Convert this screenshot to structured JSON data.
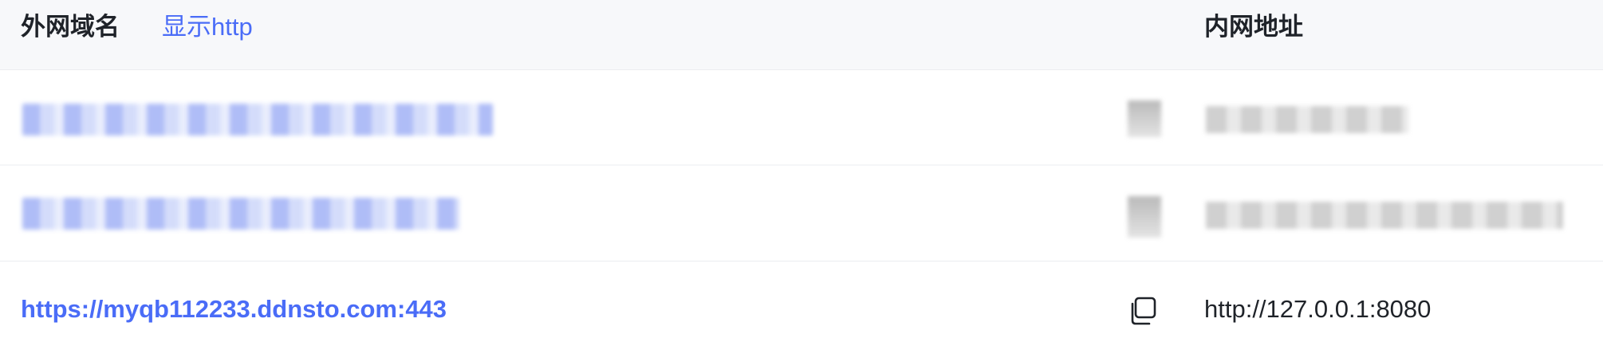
{
  "header": {
    "domain_label": "外网域名",
    "toggle_label": "显示http",
    "address_label": "内网地址"
  },
  "rows": [
    {
      "domain": "",
      "address": "",
      "redacted": true
    },
    {
      "domain": "",
      "address": "",
      "redacted": true
    },
    {
      "domain": "https://myqb112233.ddnsto.com:443",
      "address": "http://127.0.0.1:8080",
      "redacted": false
    }
  ],
  "icons": {
    "copy": "copy-icon"
  },
  "colors": {
    "link": "#4a6cf7",
    "header_bg": "#f7f8fa",
    "text": "#1f2329"
  }
}
